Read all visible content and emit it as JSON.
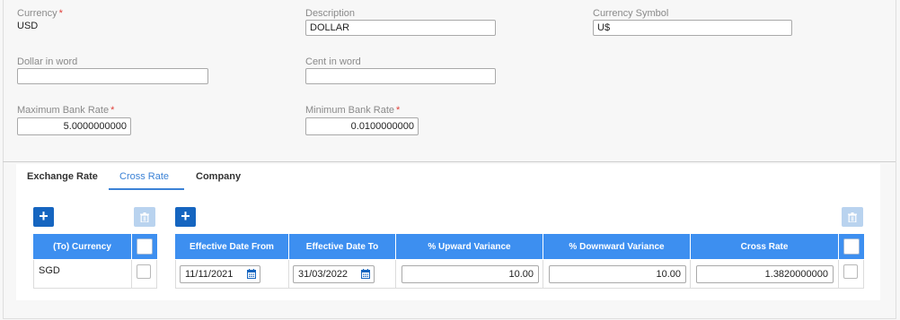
{
  "form": {
    "currency": {
      "label": "Currency",
      "value": "USD",
      "required": "*"
    },
    "description": {
      "label": "Description",
      "value": "DOLLAR"
    },
    "currency_symbol": {
      "label": "Currency Symbol",
      "value": "U$"
    },
    "dollar_in_word": {
      "label": "Dollar in word",
      "value": ""
    },
    "cent_in_word": {
      "label": "Cent in word",
      "value": ""
    },
    "max_bank_rate": {
      "label": "Maximum Bank Rate",
      "value": "5.0000000000",
      "required": "*"
    },
    "min_bank_rate": {
      "label": "Minimum Bank Rate",
      "value": "0.0100000000",
      "required": "*"
    }
  },
  "tabs": [
    {
      "label": "Exchange Rate",
      "active": false
    },
    {
      "label": "Cross Rate",
      "active": true
    },
    {
      "label": "Company",
      "active": false
    }
  ],
  "buttons": {
    "add": "+",
    "add_icon": "plus-icon",
    "delete_icon": "trash-icon"
  },
  "left_table": {
    "headers": [
      "(To) Currency"
    ],
    "rows": [
      {
        "currency": "SGD"
      }
    ]
  },
  "right_table": {
    "headers": [
      "Effective Date From",
      "Effective Date To",
      "% Upward Variance",
      "% Downward Variance",
      "Cross Rate"
    ],
    "rows": [
      {
        "date_from": "11/11/2021",
        "date_to": "31/03/2022",
        "upward": "10.00",
        "downward": "10.00",
        "cross_rate": "1.3820000000"
      }
    ]
  },
  "colors": {
    "accent": "#3d8ff0",
    "button": "#1565c0",
    "active_tab": "#3b82d6",
    "required": "#e0403a"
  }
}
